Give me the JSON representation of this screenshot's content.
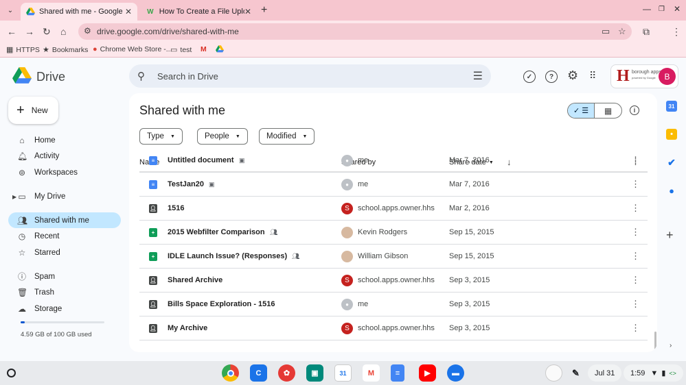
{
  "browser": {
    "tabs": [
      {
        "title": "Shared with me - Google Drive",
        "favicon": "drive-icon",
        "active": true
      },
      {
        "title": "How To Create a File Upload B",
        "favicon": "w-icon",
        "active": false
      }
    ],
    "url": "drive.google.com/drive/shared-with-me",
    "bookmarks": [
      {
        "label": "HTTPS",
        "icon": "apps-icon"
      },
      {
        "label": "Bookmarks",
        "icon": "star-icon"
      },
      {
        "label": "Chrome Web Store -...",
        "icon": "chrome-icon"
      },
      {
        "label": "test",
        "icon": "folder-icon"
      },
      {
        "label": "",
        "icon": "gmail-icon"
      },
      {
        "label": "",
        "icon": "drive-icon"
      }
    ]
  },
  "drive": {
    "brand": "Drive",
    "search_placeholder": "Search in Drive",
    "org_logo_text": "borough apps",
    "org_logo_letter": "H",
    "org_logo_sub": "powered by Google",
    "avatar_letter": "B",
    "new_label": "New",
    "nav": [
      {
        "label": "Home",
        "icon": "home-icon"
      },
      {
        "label": "Activity",
        "icon": "bell-icon"
      },
      {
        "label": "Workspaces",
        "icon": "workspaces-icon"
      },
      {
        "label": "My Drive",
        "icon": "drive-folder-icon"
      },
      {
        "label": "Shared with me",
        "icon": "people-icon",
        "selected": true
      },
      {
        "label": "Recent",
        "icon": "clock-icon"
      },
      {
        "label": "Starred",
        "icon": "star-icon"
      },
      {
        "label": "Spam",
        "icon": "spam-icon"
      },
      {
        "label": "Trash",
        "icon": "trash-icon"
      },
      {
        "label": "Storage",
        "icon": "cloud-icon"
      }
    ],
    "storage": {
      "text": "4.59 GB of 100 GB used",
      "fraction": 0.0459
    },
    "page_title": "Shared with me",
    "filters": [
      "Type",
      "People",
      "Modified"
    ],
    "columns": {
      "name": "Name",
      "shared_by": "Shared by",
      "share_date": "Share date"
    },
    "rows": [
      {
        "name": "Untitled document",
        "type": "doc",
        "tag": "offline",
        "shared_by": "me",
        "avatar": "me",
        "date": "Mar 7, 2016"
      },
      {
        "name": "TestJan20",
        "type": "doc",
        "tag": "offline",
        "shared_by": "me",
        "avatar": "me",
        "date": "Mar 7, 2016"
      },
      {
        "name": "1516",
        "type": "folder",
        "tag": "",
        "shared_by": "school.apps.owner.hhs",
        "avatar": "S",
        "date": "Mar 2, 2016"
      },
      {
        "name": "2015 Webfilter Comparison",
        "type": "sheet",
        "tag": "shared",
        "shared_by": "Kevin Rodgers",
        "avatar": "photo",
        "date": "Sep 15, 2015"
      },
      {
        "name": "IDLE Launch Issue? (Responses)",
        "type": "sheet",
        "tag": "shared",
        "shared_by": "William Gibson",
        "avatar": "photo",
        "date": "Sep 15, 2015"
      },
      {
        "name": "Shared Archive",
        "type": "folder",
        "tag": "",
        "shared_by": "school.apps.owner.hhs",
        "avatar": "S",
        "date": "Sep 3, 2015"
      },
      {
        "name": "Bills Space Exploration - 1516",
        "type": "folder",
        "tag": "",
        "shared_by": "me",
        "avatar": "me",
        "date": "Sep 3, 2015"
      },
      {
        "name": "My Archive",
        "type": "folder",
        "tag": "",
        "shared_by": "school.apps.owner.hhs",
        "avatar": "S",
        "date": "Sep 3, 2015"
      }
    ]
  },
  "shelf": {
    "date": "Jul 31",
    "time": "1:59",
    "apps": [
      "chrome-icon",
      "classroom-icon",
      "canvas-icon",
      "meet-icon",
      "calendar-icon",
      "gmail-icon",
      "docs-icon",
      "youtube-icon",
      "files-icon"
    ]
  },
  "colors": {
    "accent": "#0b57d0",
    "selected_nav": "#c2e7ff",
    "chrome_frame": "#f6c6cf"
  }
}
